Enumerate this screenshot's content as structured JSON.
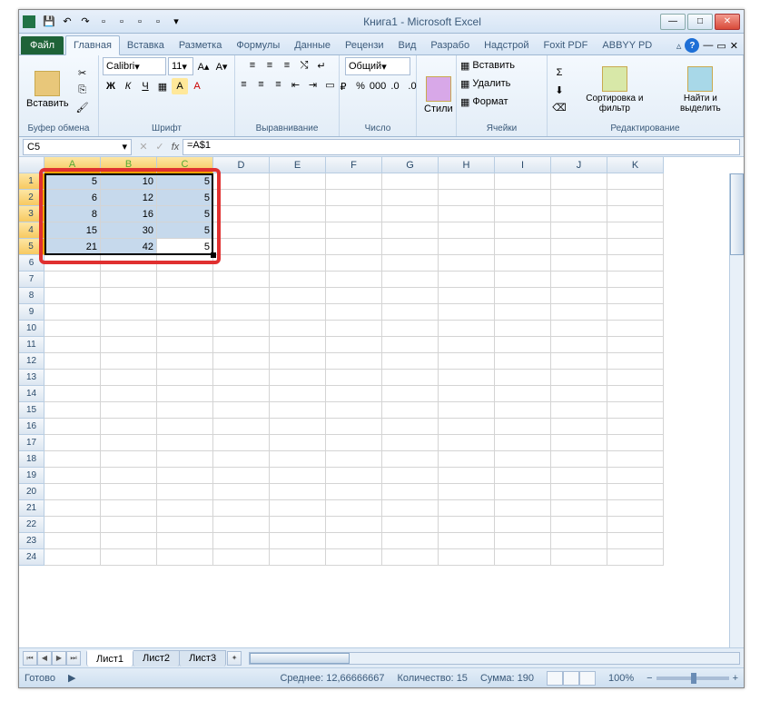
{
  "window": {
    "title": "Книга1  -  Microsoft Excel"
  },
  "qat_icons": [
    "save",
    "undo",
    "redo",
    "new",
    "open",
    "print",
    "preview",
    "quick"
  ],
  "tabs": {
    "file": "Файл",
    "items": [
      "Главная",
      "Вставка",
      "Разметка",
      "Формулы",
      "Данные",
      "Рецензи",
      "Вид",
      "Разрабо",
      "Надстрой",
      "Foxit PDF",
      "ABBYY PD"
    ],
    "active_index": 0
  },
  "ribbon": {
    "clipboard": {
      "label": "Буфер обмена",
      "paste": "Вставить"
    },
    "font": {
      "label": "Шрифт",
      "name": "Calibri",
      "size": "11"
    },
    "alignment": {
      "label": "Выравнивание"
    },
    "number": {
      "label": "Число",
      "format": "Общий"
    },
    "styles": {
      "label": "",
      "btn": "Стили"
    },
    "cells": {
      "label": "Ячейки",
      "insert": "Вставить",
      "delete": "Удалить",
      "format": "Формат"
    },
    "editing": {
      "label": "Редактирование",
      "sort": "Сортировка и фильтр",
      "find": "Найти и выделить"
    }
  },
  "namebox": "C5",
  "formula": "=A$1",
  "columns": [
    "A",
    "B",
    "C",
    "D",
    "E",
    "F",
    "G",
    "H",
    "I",
    "J",
    "K"
  ],
  "rows": 24,
  "selected_cols": [
    0,
    1,
    2
  ],
  "selected_rows": [
    0,
    1,
    2,
    3,
    4
  ],
  "active_cell": {
    "r": 4,
    "c": 2
  },
  "data": [
    [
      "5",
      "10",
      "5"
    ],
    [
      "6",
      "12",
      "5"
    ],
    [
      "8",
      "16",
      "5"
    ],
    [
      "15",
      "30",
      "5"
    ],
    [
      "21",
      "42",
      "5"
    ]
  ],
  "sheets": {
    "items": [
      "Лист1",
      "Лист2",
      "Лист3"
    ],
    "active": 0
  },
  "status": {
    "ready": "Готово",
    "avg_label": "Среднее:",
    "avg": "12,66666667",
    "count_label": "Количество:",
    "count": "15",
    "sum_label": "Сумма:",
    "sum": "190",
    "zoom": "100%"
  },
  "chart_data": {
    "type": "table",
    "columns": [
      "A",
      "B",
      "C"
    ],
    "values": [
      [
        5,
        10,
        5
      ],
      [
        6,
        12,
        5
      ],
      [
        8,
        16,
        5
      ],
      [
        15,
        30,
        5
      ],
      [
        21,
        42,
        5
      ]
    ]
  }
}
